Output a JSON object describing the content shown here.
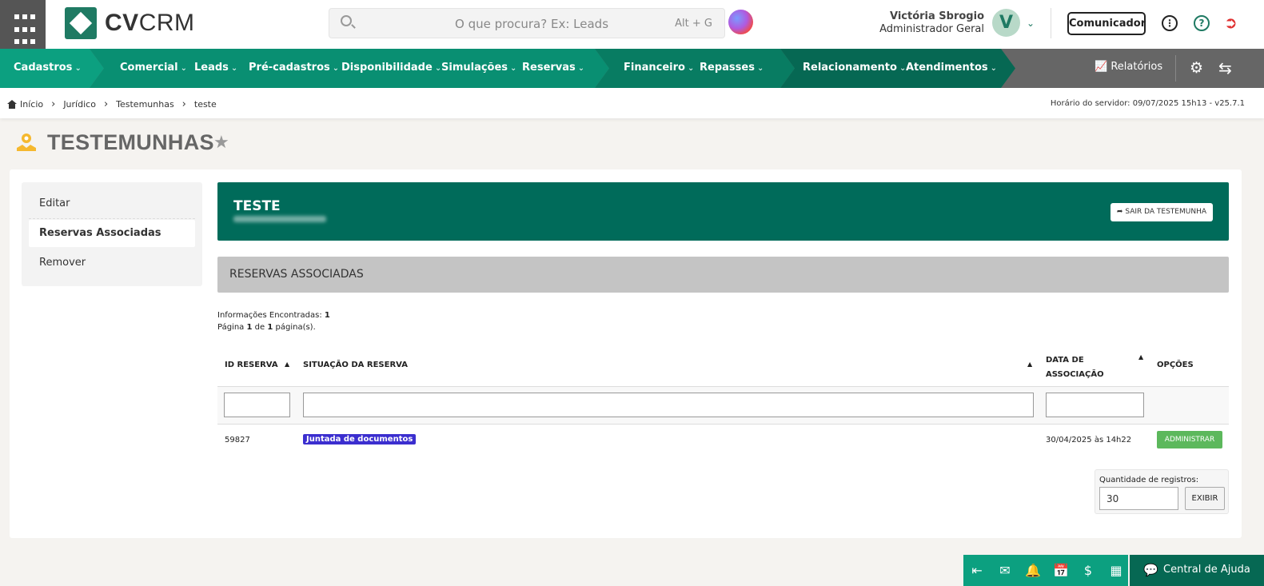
{
  "header": {
    "logo_bold": "CV",
    "logo_light": "CRM",
    "search_placeholder": "O que procura? Ex: Leads",
    "search_shortcut": "Alt + G",
    "user_name": "Victória Sbrogio",
    "user_role": "Administrador Geral",
    "avatar_letter": "V",
    "communicator_label": "Comunicador"
  },
  "nav": {
    "items": [
      "Cadastros",
      "Comercial",
      "Leads",
      "Pré-cadastros",
      "Disponibilidade",
      "Simulações",
      "Reservas",
      "Financeiro",
      "Repasses",
      "Relacionamento",
      "Atendimentos"
    ],
    "reports_label": "Relatórios"
  },
  "breadcrumb": {
    "items": [
      "Início",
      "Jurídico",
      "Testemunhas",
      "teste"
    ],
    "server_time": "Horário do servidor: 09/07/2025 15h13 - v25.7.1"
  },
  "page": {
    "title": "TESTEMUNHAS"
  },
  "sidebar": {
    "items": [
      {
        "label": "Editar"
      },
      {
        "label": "Reservas Associadas"
      },
      {
        "label": "Remover"
      }
    ]
  },
  "hero": {
    "name": "TESTE",
    "exit_label": "SAIR DA TESTEMUNHA"
  },
  "section": {
    "title": "RESERVAS ASSOCIADAS",
    "found_label": "Informações Encontradas:",
    "found_count": "1",
    "page_prefix": "Página",
    "page_current": "1",
    "page_of": "de",
    "page_total": "1",
    "page_suffix": "página(s)."
  },
  "table": {
    "headers": [
      "ID RESERVA",
      "SITUAÇÃO DA RESERVA",
      "DATA DE ASSOCIAÇÃO",
      "OPÇÕES"
    ],
    "rows": [
      {
        "id": "59827",
        "status": "Juntada de documentos",
        "date": "30/04/2025 às 14h22",
        "action": "ADMINISTRAR"
      }
    ]
  },
  "pagination": {
    "qty_label": "Quantidade de registros:",
    "qty_value": "30",
    "show_label": "EXIBIR"
  },
  "dock": {
    "help_label": "Central de Ajuda"
  },
  "colors": {
    "brand_green": "#0ca080",
    "dark_green": "#006b5a",
    "status_badge": "#3b2ecf",
    "admin_button": "#5cb85c"
  }
}
